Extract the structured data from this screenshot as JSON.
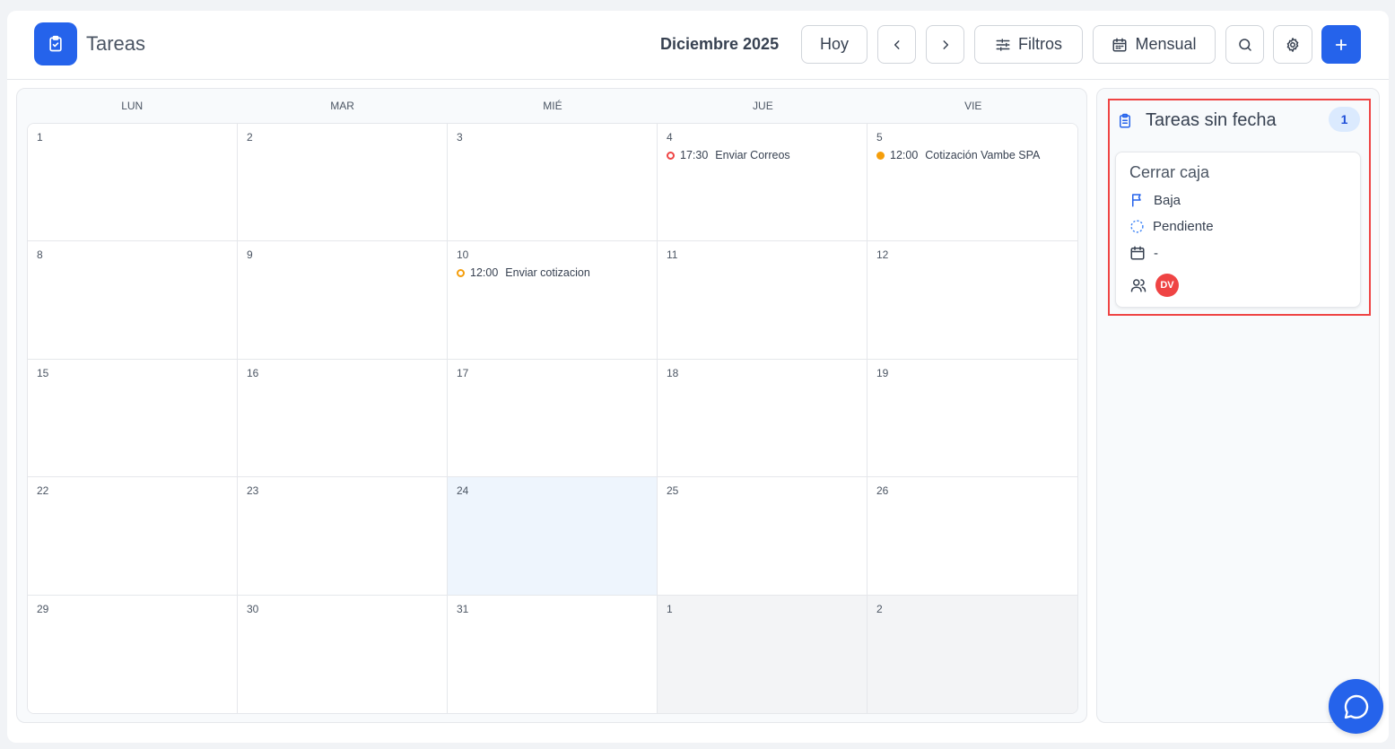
{
  "header": {
    "app_title": "Tareas",
    "month_label": "Diciembre 2025",
    "today_label": "Hoy",
    "filters_label": "Filtros",
    "view_label": "Mensual"
  },
  "calendar": {
    "weekdays": [
      "LUN",
      "MAR",
      "MIÉ",
      "JUE",
      "VIE"
    ],
    "weeks": [
      [
        {
          "day": "1",
          "events": []
        },
        {
          "day": "2",
          "events": []
        },
        {
          "day": "3",
          "events": []
        },
        {
          "day": "4",
          "events": [
            {
              "time": "17:30",
              "title": "Enviar Correos",
              "status": "red-ring"
            }
          ]
        },
        {
          "day": "5",
          "events": [
            {
              "time": "12:00",
              "title": "Cotización Vambe SPA",
              "status": "orange-fill"
            }
          ]
        }
      ],
      [
        {
          "day": "8",
          "events": []
        },
        {
          "day": "9",
          "events": []
        },
        {
          "day": "10",
          "events": [
            {
              "time": "12:00",
              "title": "Enviar cotizacion",
              "status": "orange-ring"
            }
          ]
        },
        {
          "day": "11",
          "events": []
        },
        {
          "day": "12",
          "events": []
        }
      ],
      [
        {
          "day": "15",
          "events": []
        },
        {
          "day": "16",
          "events": []
        },
        {
          "day": "17",
          "events": []
        },
        {
          "day": "18",
          "events": []
        },
        {
          "day": "19",
          "events": []
        }
      ],
      [
        {
          "day": "22",
          "events": []
        },
        {
          "day": "23",
          "events": []
        },
        {
          "day": "24",
          "events": [],
          "today": true
        },
        {
          "day": "25",
          "events": []
        },
        {
          "day": "26",
          "events": []
        }
      ],
      [
        {
          "day": "29",
          "events": []
        },
        {
          "day": "30",
          "events": []
        },
        {
          "day": "31",
          "events": []
        },
        {
          "day": "1",
          "events": [],
          "other_month": true
        },
        {
          "day": "2",
          "events": [],
          "other_month": true
        }
      ]
    ]
  },
  "side_panel": {
    "title": "Tareas sin fecha",
    "count": "1",
    "task": {
      "title": "Cerrar caja",
      "priority": "Baja",
      "status": "Pendiente",
      "date": "-",
      "assignee_initials": "DV"
    }
  },
  "colors": {
    "primary": "#2563eb",
    "today_bg": "#eef5fd",
    "other_month_bg": "#f3f4f6",
    "highlight": "#ef4444",
    "status_red": "#ef4444",
    "status_orange": "#f59e0b"
  },
  "icons": {
    "logo": "clipboard-check-icon",
    "prev": "chevron-left-icon",
    "next": "chevron-right-icon",
    "filters": "sliders-icon",
    "view": "calendar-icon",
    "search": "search-icon",
    "settings": "gear-icon",
    "add": "plus-icon",
    "priority": "flag-icon",
    "status": "dashed-circle-icon",
    "date": "calendar-icon",
    "assignees": "users-icon",
    "chat": "chat-bubble-icon"
  }
}
